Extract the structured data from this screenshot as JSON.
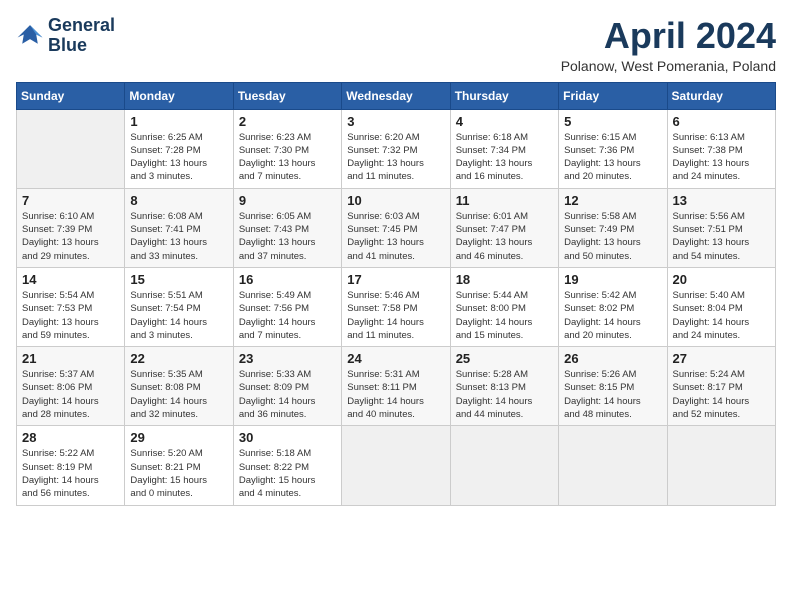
{
  "header": {
    "logo_line1": "General",
    "logo_line2": "Blue",
    "month_title": "April 2024",
    "location": "Polanow, West Pomerania, Poland"
  },
  "weekdays": [
    "Sunday",
    "Monday",
    "Tuesday",
    "Wednesday",
    "Thursday",
    "Friday",
    "Saturday"
  ],
  "weeks": [
    [
      {
        "day": "",
        "info": ""
      },
      {
        "day": "1",
        "info": "Sunrise: 6:25 AM\nSunset: 7:28 PM\nDaylight: 13 hours\nand 3 minutes."
      },
      {
        "day": "2",
        "info": "Sunrise: 6:23 AM\nSunset: 7:30 PM\nDaylight: 13 hours\nand 7 minutes."
      },
      {
        "day": "3",
        "info": "Sunrise: 6:20 AM\nSunset: 7:32 PM\nDaylight: 13 hours\nand 11 minutes."
      },
      {
        "day": "4",
        "info": "Sunrise: 6:18 AM\nSunset: 7:34 PM\nDaylight: 13 hours\nand 16 minutes."
      },
      {
        "day": "5",
        "info": "Sunrise: 6:15 AM\nSunset: 7:36 PM\nDaylight: 13 hours\nand 20 minutes."
      },
      {
        "day": "6",
        "info": "Sunrise: 6:13 AM\nSunset: 7:38 PM\nDaylight: 13 hours\nand 24 minutes."
      }
    ],
    [
      {
        "day": "7",
        "info": "Sunrise: 6:10 AM\nSunset: 7:39 PM\nDaylight: 13 hours\nand 29 minutes."
      },
      {
        "day": "8",
        "info": "Sunrise: 6:08 AM\nSunset: 7:41 PM\nDaylight: 13 hours\nand 33 minutes."
      },
      {
        "day": "9",
        "info": "Sunrise: 6:05 AM\nSunset: 7:43 PM\nDaylight: 13 hours\nand 37 minutes."
      },
      {
        "day": "10",
        "info": "Sunrise: 6:03 AM\nSunset: 7:45 PM\nDaylight: 13 hours\nand 41 minutes."
      },
      {
        "day": "11",
        "info": "Sunrise: 6:01 AM\nSunset: 7:47 PM\nDaylight: 13 hours\nand 46 minutes."
      },
      {
        "day": "12",
        "info": "Sunrise: 5:58 AM\nSunset: 7:49 PM\nDaylight: 13 hours\nand 50 minutes."
      },
      {
        "day": "13",
        "info": "Sunrise: 5:56 AM\nSunset: 7:51 PM\nDaylight: 13 hours\nand 54 minutes."
      }
    ],
    [
      {
        "day": "14",
        "info": "Sunrise: 5:54 AM\nSunset: 7:53 PM\nDaylight: 13 hours\nand 59 minutes."
      },
      {
        "day": "15",
        "info": "Sunrise: 5:51 AM\nSunset: 7:54 PM\nDaylight: 14 hours\nand 3 minutes."
      },
      {
        "day": "16",
        "info": "Sunrise: 5:49 AM\nSunset: 7:56 PM\nDaylight: 14 hours\nand 7 minutes."
      },
      {
        "day": "17",
        "info": "Sunrise: 5:46 AM\nSunset: 7:58 PM\nDaylight: 14 hours\nand 11 minutes."
      },
      {
        "day": "18",
        "info": "Sunrise: 5:44 AM\nSunset: 8:00 PM\nDaylight: 14 hours\nand 15 minutes."
      },
      {
        "day": "19",
        "info": "Sunrise: 5:42 AM\nSunset: 8:02 PM\nDaylight: 14 hours\nand 20 minutes."
      },
      {
        "day": "20",
        "info": "Sunrise: 5:40 AM\nSunset: 8:04 PM\nDaylight: 14 hours\nand 24 minutes."
      }
    ],
    [
      {
        "day": "21",
        "info": "Sunrise: 5:37 AM\nSunset: 8:06 PM\nDaylight: 14 hours\nand 28 minutes."
      },
      {
        "day": "22",
        "info": "Sunrise: 5:35 AM\nSunset: 8:08 PM\nDaylight: 14 hours\nand 32 minutes."
      },
      {
        "day": "23",
        "info": "Sunrise: 5:33 AM\nSunset: 8:09 PM\nDaylight: 14 hours\nand 36 minutes."
      },
      {
        "day": "24",
        "info": "Sunrise: 5:31 AM\nSunset: 8:11 PM\nDaylight: 14 hours\nand 40 minutes."
      },
      {
        "day": "25",
        "info": "Sunrise: 5:28 AM\nSunset: 8:13 PM\nDaylight: 14 hours\nand 44 minutes."
      },
      {
        "day": "26",
        "info": "Sunrise: 5:26 AM\nSunset: 8:15 PM\nDaylight: 14 hours\nand 48 minutes."
      },
      {
        "day": "27",
        "info": "Sunrise: 5:24 AM\nSunset: 8:17 PM\nDaylight: 14 hours\nand 52 minutes."
      }
    ],
    [
      {
        "day": "28",
        "info": "Sunrise: 5:22 AM\nSunset: 8:19 PM\nDaylight: 14 hours\nand 56 minutes."
      },
      {
        "day": "29",
        "info": "Sunrise: 5:20 AM\nSunset: 8:21 PM\nDaylight: 15 hours\nand 0 minutes."
      },
      {
        "day": "30",
        "info": "Sunrise: 5:18 AM\nSunset: 8:22 PM\nDaylight: 15 hours\nand 4 minutes."
      },
      {
        "day": "",
        "info": ""
      },
      {
        "day": "",
        "info": ""
      },
      {
        "day": "",
        "info": ""
      },
      {
        "day": "",
        "info": ""
      }
    ]
  ]
}
